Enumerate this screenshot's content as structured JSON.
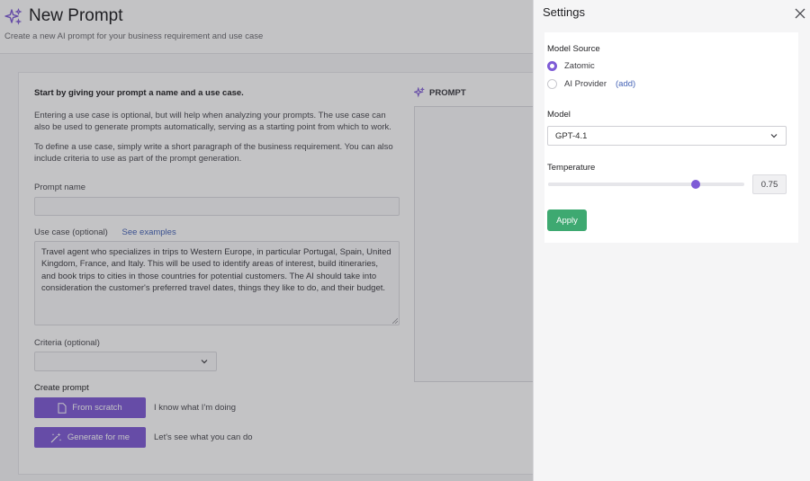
{
  "header": {
    "title": "New Prompt",
    "subtitle": "Create a new AI prompt for your business requirement and use case"
  },
  "form": {
    "intro_heading": "Start by giving your prompt a name and a use case.",
    "intro_para_1": "Entering a use case is optional, but will help when analyzing your prompts. The use case can also be used to generate prompts automatically, serving as a starting point from which to work.",
    "intro_para_2": "To define a use case, simply write a short paragraph of the business requirement. You can also include criteria to use as part of the prompt generation.",
    "prompt_name_label": "Prompt name",
    "prompt_name_value": "",
    "use_case_label": "Use case (optional)",
    "see_examples_link": "See examples",
    "use_case_value": "Travel agent who specializes in trips to Western Europe, in particular Portugal, Spain, United Kingdom, France, and Italy. This will be used to identify areas of interest, build itineraries, and book trips to cities in those countries for potential customers. The AI should take into consideration the customer's preferred travel dates, things they like to do, and their budget.",
    "criteria_label": "Criteria (optional)",
    "criteria_value": "",
    "create_prompt_label": "Create prompt",
    "from_scratch_button": "From scratch",
    "from_scratch_note": "I know what I'm doing",
    "generate_button": "Generate for me",
    "generate_note": "Let's see what you can do"
  },
  "prompt_panel": {
    "heading": "PROMPT"
  },
  "settings": {
    "title": "Settings",
    "model_source_label": "Model Source",
    "sources": [
      {
        "label": "Zatomic",
        "selected": true
      },
      {
        "label": "AI Provider",
        "selected": false
      }
    ],
    "add_link": "(add)",
    "model_label": "Model",
    "model_value": "GPT-4.1",
    "temperature_label": "Temperature",
    "temperature_value": "0.75",
    "temperature_level": 0.75,
    "apply_button": "Apply"
  },
  "colors": {
    "accent": "#7e5bd6",
    "apply_green": "#3ea971",
    "link_blue": "#4563b6"
  },
  "icons": {
    "header": "sparkle-icon",
    "close": "close-icon",
    "from_scratch": "document-icon",
    "generate": "magic-wand-icon",
    "dropdown": "chevron-down-icon"
  }
}
